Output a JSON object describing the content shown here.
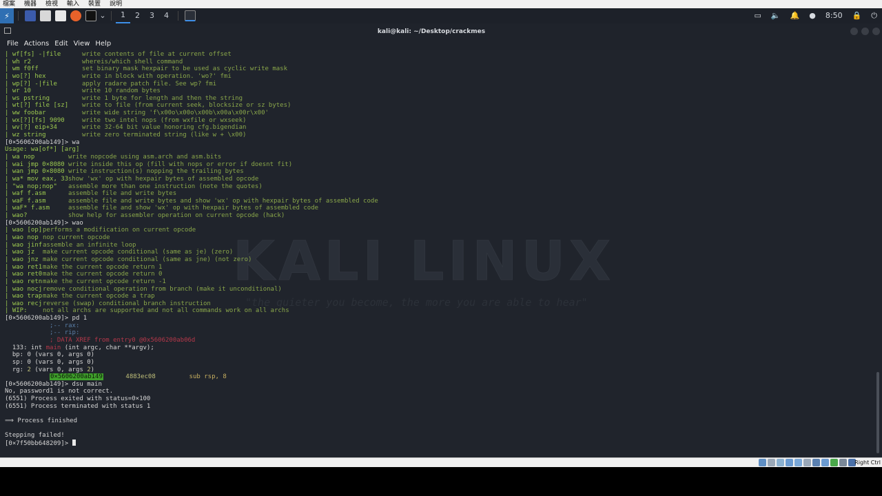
{
  "host_menu": [
    "檔案",
    "機器",
    "檢視",
    "輸入",
    "裝置",
    "說明"
  ],
  "panel": {
    "workspaces": [
      "1",
      "2",
      "3",
      "4"
    ],
    "clock": "8:50"
  },
  "window": {
    "title": "kali@kali: ~/Desktop/crackmes"
  },
  "menubar": [
    "File",
    "Actions",
    "Edit",
    "View",
    "Help"
  ],
  "watermark": {
    "title": "KALI LINUX",
    "quote": "\"the quieter you become, the more you are able to hear\""
  },
  "help_w": [
    {
      "cmd": "| wf[fs] -|file",
      "desc": "write contents of file at current offset"
    },
    {
      "cmd": "| wh r2",
      "desc": "whereis/which shell command"
    },
    {
      "cmd": "| wm f0ff",
      "desc": "set binary mask hexpair to be used as cyclic write mask"
    },
    {
      "cmd": "| wo[?] hex",
      "desc": "write in block with operation. 'wo?' fmi"
    },
    {
      "cmd": "| wp[?] -|file",
      "desc": "apply radare patch file. See wp? fmi"
    },
    {
      "cmd": "| wr 10",
      "desc": "write 10 random bytes"
    },
    {
      "cmd": "| ws pstring",
      "desc": "write 1 byte for length and then the string"
    },
    {
      "cmd": "| wt[?] file [sz]",
      "desc": "write to file (from current seek, blocksize or sz bytes)"
    },
    {
      "cmd": "| ww foobar",
      "desc": "write wide string 'f\\x00o\\x00o\\x00b\\x00a\\x00r\\x00'"
    },
    {
      "cmd": "| wx[?][fs] 9090",
      "desc": "write two intel nops (from wxfile or wxseek)"
    },
    {
      "cmd": "| wv[?] eip+34",
      "desc": "write 32-64 bit value honoring cfg.bigendian"
    },
    {
      "cmd": "| wz string",
      "desc": "write zero terminated string (like w + \\x00)"
    }
  ],
  "prompt_wa": "[0×5606200ab149]> wa",
  "usage_wa": "Usage: wa[of*] [arg]",
  "help_wa": [
    {
      "cmd": "| wa nop",
      "desc": "write nopcode using asm.arch and asm.bits"
    },
    {
      "cmd": "| wai jmp 0×8080",
      "desc": "write inside this op (fill with nops or error if doesnt fit)"
    },
    {
      "cmd": "| wan jmp 0×8080",
      "desc": "write instruction(s) nopping the trailing bytes"
    },
    {
      "cmd": "| wa* mov eax, 33",
      "desc": "show 'wx' op with hexpair bytes of assembled opcode"
    },
    {
      "cmd": "| \"wa nop;nop\"",
      "desc": "assemble more than one instruction (note the quotes)"
    },
    {
      "cmd": "| waf f.asm",
      "desc": "assemble file and write bytes"
    },
    {
      "cmd": "| waF f.asm",
      "desc": "assemble file and write bytes and show 'wx' op with hexpair bytes of assembled code"
    },
    {
      "cmd": "| waF* f.asm",
      "desc": "assemble file and show 'wx' op with hexpair bytes of assembled code"
    },
    {
      "cmd": "| wao?",
      "desc": "show help for assembler operation on current opcode (hack)"
    }
  ],
  "prompt_wao": "[0×5606200ab149]> wao",
  "help_wao": [
    {
      "cmd": "| wao [op]",
      "desc": "performs a modification on current opcode"
    },
    {
      "cmd": "| wao nop",
      "desc": "nop current opcode"
    },
    {
      "cmd": "| wao jinf",
      "desc": "assemble an infinite loop"
    },
    {
      "cmd": "| wao jz",
      "desc": "make current opcode conditional (same as je) (zero)"
    },
    {
      "cmd": "| wao jnz",
      "desc": "make current opcode conditional (same as jne) (not zero)"
    },
    {
      "cmd": "| wao ret1",
      "desc": "make the current opcode return 1"
    },
    {
      "cmd": "| wao ret0",
      "desc": "make the current opcode return 0"
    },
    {
      "cmd": "| wao retn",
      "desc": "make the current opcode return -1"
    },
    {
      "cmd": "| wao nocj",
      "desc": "remove conditional operation from branch (make it unconditional)"
    },
    {
      "cmd": "| wao trap",
      "desc": "make the current opcode a trap"
    },
    {
      "cmd": "| wao recj",
      "desc": "reverse (swap) conditional branch instruction"
    },
    {
      "cmd": "| WIP:",
      "desc": "not all archs are supported and not all commands work on all archs"
    }
  ],
  "prompt_pd": "[0×5606200ab149]> pd 1",
  "disasm": {
    "rax": "            ;-- rax:",
    "rip": "            ;-- rip:",
    "xref": "            ; DATA XREF from entry0 @0x5606200ab06d",
    "func_prefix": "  133: int ",
    "func_name": "main",
    "func_args": " (int argc, char **argv);",
    "bp": "  bp: 0 (vars 0, args 0)",
    "sp": "  sp: 0 (vars 0, args 0)",
    "rg_prefix": "  rg: ",
    "rg_num1": "2",
    "rg_mid": " (vars 0, args ",
    "rg_num2": "2",
    "rg_end": ")",
    "addr": "0×5606200ab149",
    "bytes": "4883ec08",
    "mnemonic": "sub",
    "operands": "rsp, 8"
  },
  "prompt_dsu": "[0×5606200ab149]> dsu main",
  "output": [
    "No, password1 is not correct.",
    "(6551) Process exited with status=0×100",
    "(6551) Process terminated with status 1"
  ],
  "finished": "⟹ Process finished",
  "stepping": "Stepping failed!",
  "final_prompt": "[0×7f50bb648209]> ",
  "vbox": {
    "right_ctrl": "Right Ctrl"
  }
}
